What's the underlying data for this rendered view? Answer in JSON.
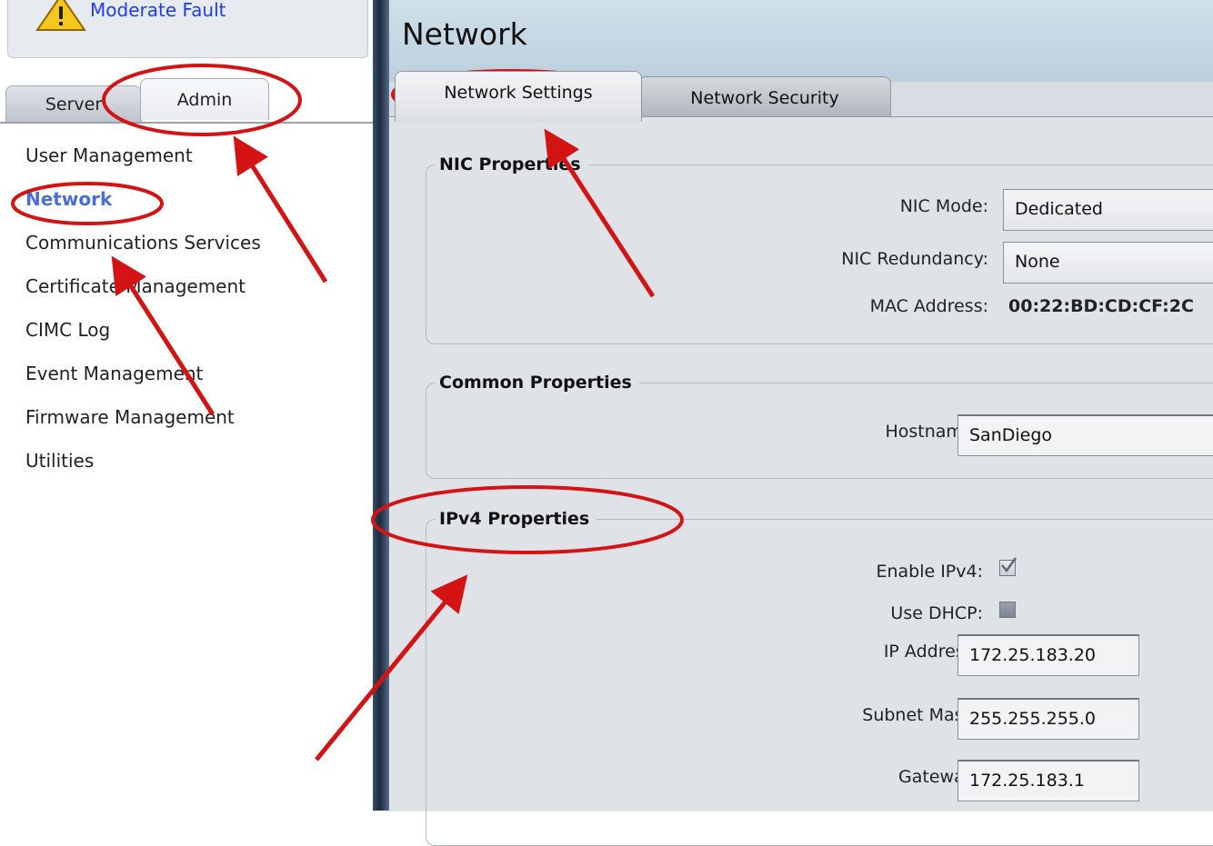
{
  "fault": {
    "text": "Moderate Fault",
    "icon": "warning-icon"
  },
  "left_tabs": [
    {
      "label": "Server"
    },
    {
      "label": "Admin"
    }
  ],
  "nav": [
    {
      "label": "User Management"
    },
    {
      "label": "Network"
    },
    {
      "label": "Communications Services"
    },
    {
      "label": "Certificate Management"
    },
    {
      "label": "CIMC Log"
    },
    {
      "label": "Event Management"
    },
    {
      "label": "Firmware Management"
    },
    {
      "label": "Utilities"
    }
  ],
  "page": {
    "title": "Network",
    "tabs": [
      {
        "label": "Network Settings"
      },
      {
        "label": "Network Security"
      }
    ]
  },
  "nic": {
    "legend": "NIC Properties",
    "mode_label": "NIC Mode:",
    "mode_value": "Dedicated",
    "redundancy_label": "NIC Redundancy:",
    "redundancy_value": "None",
    "mac_label": "MAC Address:",
    "mac_value": "00:22:BD:CD:CF:2C"
  },
  "common": {
    "legend": "Common Properties",
    "hostname_label": "Hostname:",
    "hostname_value": "SanDiego"
  },
  "ipv4": {
    "legend": "IPv4 Properties",
    "enable_label": "Enable IPv4:",
    "enable_checked": true,
    "dhcp_label": "Use DHCP:",
    "dhcp_checked": false,
    "ip_label": "IP Address:",
    "ip_value": "172.25.183.20",
    "mask_label": "Subnet Mask:",
    "mask_value": "255.255.255.0",
    "gateway_label": "Gateway:",
    "gateway_value": "172.25.183.1"
  },
  "colors": {
    "annotation": "#d41414",
    "nav_active": "#4a6fd4",
    "fault_link": "#1e3cf0",
    "splitter": "#1c2a3d"
  }
}
